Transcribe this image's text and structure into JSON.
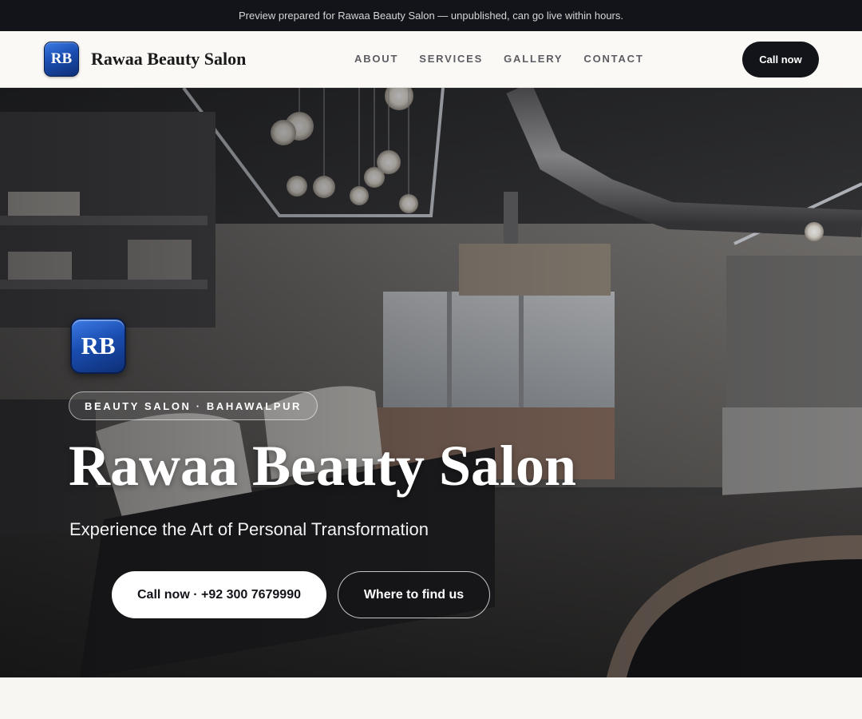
{
  "banner": {
    "text": "Preview prepared for Rawaa Beauty Salon — unpublished, can go live within hours."
  },
  "brand": {
    "initials": "RB",
    "name": "Rawaa Beauty Salon"
  },
  "nav": {
    "items": [
      {
        "label": "ABOUT"
      },
      {
        "label": "SERVICES"
      },
      {
        "label": "GALLERY"
      },
      {
        "label": "CONTACT"
      }
    ],
    "cta_label": "Call now"
  },
  "hero": {
    "logo_initials": "RB",
    "tag": "BEAUTY SALON · BAHAWALPUR",
    "title": "Rawaa Beauty Salon",
    "subtitle": "Experience the Art of Personal Transformation",
    "primary_button": "Call now · +92 300 7679990",
    "secondary_button": "Where to find us",
    "background_image": "salon-interior-photo"
  },
  "colors": {
    "dark": "#121419",
    "logo_blue": "#1a4db0",
    "page_bg": "#f8f6f2"
  }
}
